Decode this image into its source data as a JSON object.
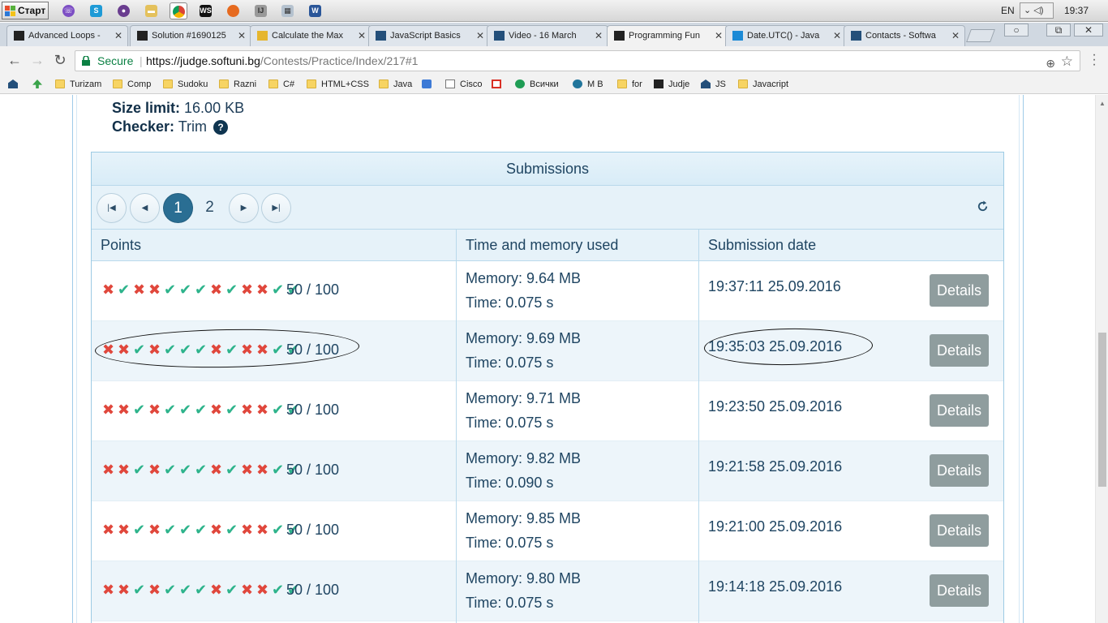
{
  "taskbar": {
    "start_label": "Старт",
    "quicklaunch": [
      "viber-icon",
      "skype-icon",
      "tor-icon",
      "explorer-icon",
      "chrome-icon",
      "webstorm-icon",
      "firefox-icon",
      "intellij-icon",
      "calculator-icon",
      "word-icon"
    ],
    "lang": "EN",
    "clock": "19:37"
  },
  "tabs": [
    {
      "title": "Advanced Loops -",
      "icon": "softuni-dark-icon"
    },
    {
      "title": "Solution #1690125",
      "icon": "softuni-dark-icon"
    },
    {
      "title": "Calculate the Max",
      "icon": "page-yellow-icon"
    },
    {
      "title": "JavaScript Basics",
      "icon": "softuni-hat-icon"
    },
    {
      "title": "Video - 16 March",
      "icon": "softuni-hat-icon"
    },
    {
      "title": "Programming Fun",
      "icon": "softuni-dark-icon",
      "active": true
    },
    {
      "title": "Date.UTC() - Java",
      "icon": "mdn-icon"
    },
    {
      "title": "Contacts - Softwa",
      "icon": "softuni-hat-icon"
    }
  ],
  "address": {
    "secure": "Secure",
    "host": "https://judge.softuni.bg",
    "path": "/Contests/Practice/Index/217#1"
  },
  "bookmarks": [
    {
      "label": "",
      "icon": "softuni-hat-icon"
    },
    {
      "label": "",
      "icon": "green-arrow-icon"
    },
    {
      "label": "Turizam",
      "icon": "folder-icon"
    },
    {
      "label": "Comp",
      "icon": "folder-icon"
    },
    {
      "label": "Sudoku",
      "icon": "folder-icon"
    },
    {
      "label": "Razni",
      "icon": "folder-icon"
    },
    {
      "label": "C#",
      "icon": "folder-icon"
    },
    {
      "label": "HTML+CSS",
      "icon": "folder-icon"
    },
    {
      "label": "Java",
      "icon": "folder-icon"
    },
    {
      "label": "",
      "icon": "contact-icon"
    },
    {
      "label": "Cisco",
      "icon": "page-icon"
    },
    {
      "label": "",
      "icon": "gmail-icon"
    },
    {
      "label": "Всички",
      "icon": "link-icon"
    },
    {
      "label": "M B",
      "icon": "wordpress-icon"
    },
    {
      "label": "for",
      "icon": "folder-icon"
    },
    {
      "label": "Judje",
      "icon": "softuni-dark-icon"
    },
    {
      "label": "JS",
      "icon": "softuni-hat-icon"
    },
    {
      "label": "Javacript",
      "icon": "folder-icon"
    }
  ],
  "problem": {
    "size_label": "Size limit:",
    "size_value": "16.00 KB",
    "checker_label": "Checker:",
    "checker_value": "Trim"
  },
  "submissions": {
    "title": "Submissions",
    "pages": [
      "1",
      "2"
    ],
    "current_page": "1",
    "columns": [
      "Points",
      "Time and memory used",
      "Submission date"
    ],
    "details_label": "Details",
    "rows": [
      {
        "tests": "xvxxvvvxvxxvv",
        "points": "50 / 100",
        "memory": "Memory: 9.64 MB",
        "time": "Time: 0.075 s",
        "date": "19:37:11 25.09.2016"
      },
      {
        "tests": "xxvxvvvxvxxvv",
        "points": "50 / 100",
        "memory": "Memory: 9.69 MB",
        "time": "Time: 0.075 s",
        "date": "19:35:03 25.09.2016"
      },
      {
        "tests": "xxvxvvvxvxxvv",
        "points": "50 / 100",
        "memory": "Memory: 9.71 MB",
        "time": "Time: 0.075 s",
        "date": "19:23:50 25.09.2016"
      },
      {
        "tests": "xxvxvvvxvxxvv",
        "points": "50 / 100",
        "memory": "Memory: 9.82 MB",
        "time": "Time: 0.090 s",
        "date": "19:21:58 25.09.2016"
      },
      {
        "tests": "xxvxvvvxvxxvv",
        "points": "50 / 100",
        "memory": "Memory: 9.85 MB",
        "time": "Time: 0.075 s",
        "date": "19:21:00 25.09.2016"
      },
      {
        "tests": "xxvxvvvxvxxvv",
        "points": "50 / 100",
        "memory": "Memory: 9.80 MB",
        "time": "Time: 0.075 s",
        "date": "19:14:18 25.09.2016"
      }
    ]
  },
  "colors": {
    "pass": "#2db38b",
    "fail": "#e0473c",
    "accent": "#2a6e93",
    "details_button": "#8f9d9e"
  }
}
